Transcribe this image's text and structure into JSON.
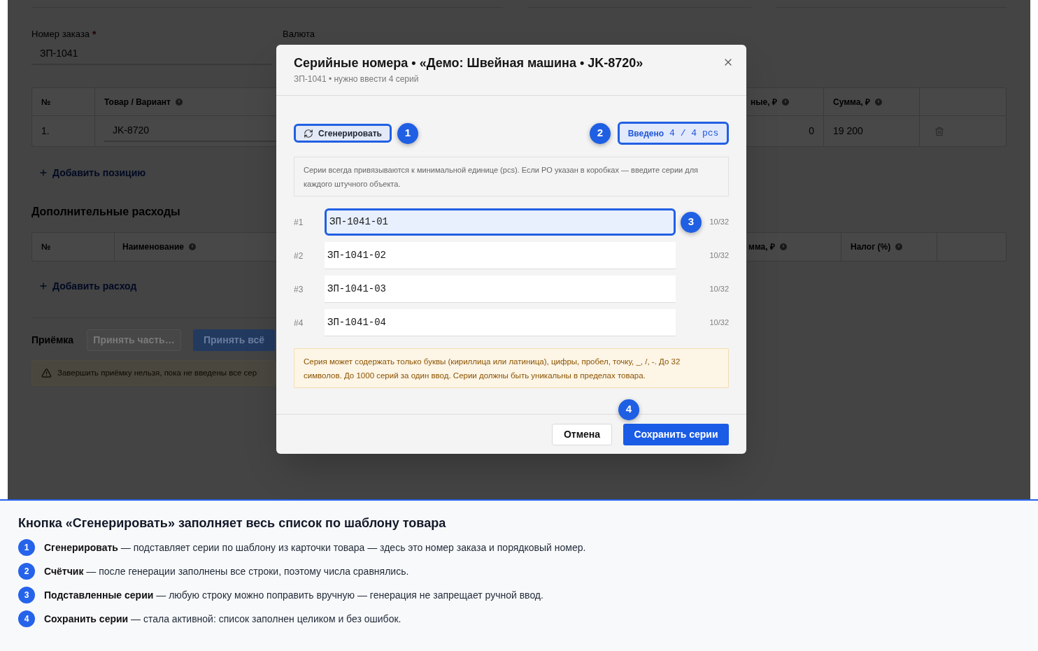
{
  "background": {
    "order_number": {
      "label": "Номер заказа",
      "required_mark": "*",
      "value": "ЗП-1041"
    },
    "currency": {
      "label": "Валюта"
    },
    "items_table": {
      "columns": [
        {
          "label": "№",
          "info": false
        },
        {
          "label": "Товар / Вариант",
          "info": true
        },
        {
          "label": "ные, ₽",
          "info": true
        },
        {
          "label": "Сумма, ₽",
          "info": true
        }
      ],
      "rows": [
        {
          "index": "1.",
          "product": "JK-8720",
          "column_3": "0",
          "total": "19 200"
        }
      ]
    },
    "add_item_link": "Добавить позицию",
    "expenses": {
      "title": "Дополнительные расходы",
      "columns": [
        {
          "label": "№",
          "info": false
        },
        {
          "label": "Наименование",
          "info": true
        },
        {
          "label": "мма, ₽",
          "info": true
        },
        {
          "label": "Налог (%)",
          "info": true
        }
      ]
    },
    "add_expense_link": "Добавить расход",
    "receiving": {
      "title": "Приёмка",
      "buttons": [
        {
          "label": "Принять часть…",
          "kind": "secondary",
          "disabled": true
        },
        {
          "label": "Принять всё",
          "kind": "primary",
          "disabled": true
        }
      ],
      "warning": "Завершить приёмку нельзя, пока не введены все сер"
    }
  },
  "dialog": {
    "title": "Серийные номера • «Демо: Швейная машина • JK-8720»",
    "subtitle": "ЗП-1041 • нужно ввести 4 серий",
    "generate_button": {
      "label": "Сгенерировать",
      "highlighted": true,
      "callout": "1"
    },
    "counter": {
      "label": "Введено",
      "value": "4 / 4 pcs",
      "highlighted": true,
      "callout": "2"
    },
    "hint": "Серии всегда привязываются к минимальной единице (pcs). Если PO указан в коробках — введите серии для каждого штучного объекта.",
    "serials": [
      {
        "index": "#1",
        "value": "ЗП-1041-01",
        "count": "10/32",
        "focused": true,
        "callout": "3"
      },
      {
        "index": "#2",
        "value": "ЗП-1041-02",
        "count": "10/32",
        "focused": false
      },
      {
        "index": "#3",
        "value": "ЗП-1041-03",
        "count": "10/32",
        "focused": false
      },
      {
        "index": "#4",
        "value": "ЗП-1041-04",
        "count": "10/32",
        "focused": false
      }
    ],
    "rules": "Серия может содержать только буквы (кириллица или латиница), цифры, пробел, точку, _, /, -. До 32 символов. До 1000 серий за один ввод. Серии должны быть уникальны в пределах товара.",
    "buttons": [
      {
        "label": "Отмена",
        "kind": "secondary"
      },
      {
        "label": "Сохранить серии",
        "kind": "primary",
        "callout": "4"
      }
    ]
  },
  "legend": {
    "title": "Кнопка «Сгенерировать» заполняет весь список по шаблону товара",
    "items": [
      {
        "number": "1",
        "text": "**Сгенерировать** — подставляет серии по шаблону из карточки товара — здесь это номер заказа и порядковый номер."
      },
      {
        "number": "2",
        "text": "**Счётчик** — после генерации заполнены все строки, поэтому числа сравнялись."
      },
      {
        "number": "3",
        "text": "**Подставленные серии** — любую строку можно поправить вручную — генерация не запрещает ручной ввод."
      },
      {
        "number": "4",
        "text": "**Сохранить серии** — стала активной: список заполнен целиком и без ошибок."
      }
    ]
  }
}
